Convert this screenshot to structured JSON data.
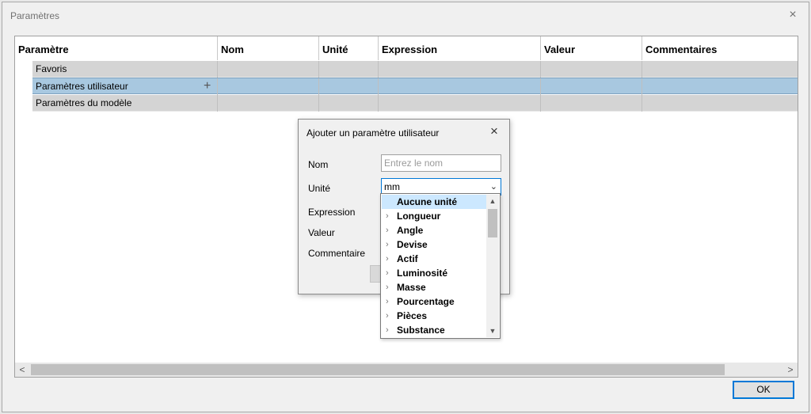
{
  "window": {
    "title": "Paramètres",
    "close_icon": "×"
  },
  "table": {
    "columns": [
      "Paramètre",
      "Nom",
      "Unité",
      "Expression",
      "Valeur",
      "Commentaires"
    ],
    "rows": [
      {
        "label": "Favoris"
      },
      {
        "label": "Paramètres utilisateur",
        "add_icon": "+"
      },
      {
        "label": "Paramètres du modèle"
      }
    ]
  },
  "scrollbar": {
    "left_arrow": "<",
    "right_arrow": ">"
  },
  "footer": {
    "ok_label": "OK"
  },
  "dialog": {
    "title": "Ajouter un paramètre utilisateur",
    "close_icon": "×",
    "labels": {
      "nom": "Nom",
      "unite": "Unité",
      "expression": "Expression",
      "valeur": "Valeur",
      "commentaire": "Commentaire"
    },
    "nom_placeholder": "Entrez le nom",
    "unite_value": "mm",
    "dropdown_chevron": "⌄"
  },
  "dropdown": {
    "items": [
      "Aucune unité",
      "Longueur",
      "Angle",
      "Devise",
      "Actif",
      "Luminosité",
      "Masse",
      "Pourcentage",
      "Pièces",
      "Substance"
    ],
    "scroll_up": "▲",
    "scroll_down": "▼",
    "expand_chevron": "›"
  },
  "colors": {
    "selected_row": "#a8c8e0",
    "focus_border": "#0078d7",
    "highlight_item": "#cce8ff"
  }
}
